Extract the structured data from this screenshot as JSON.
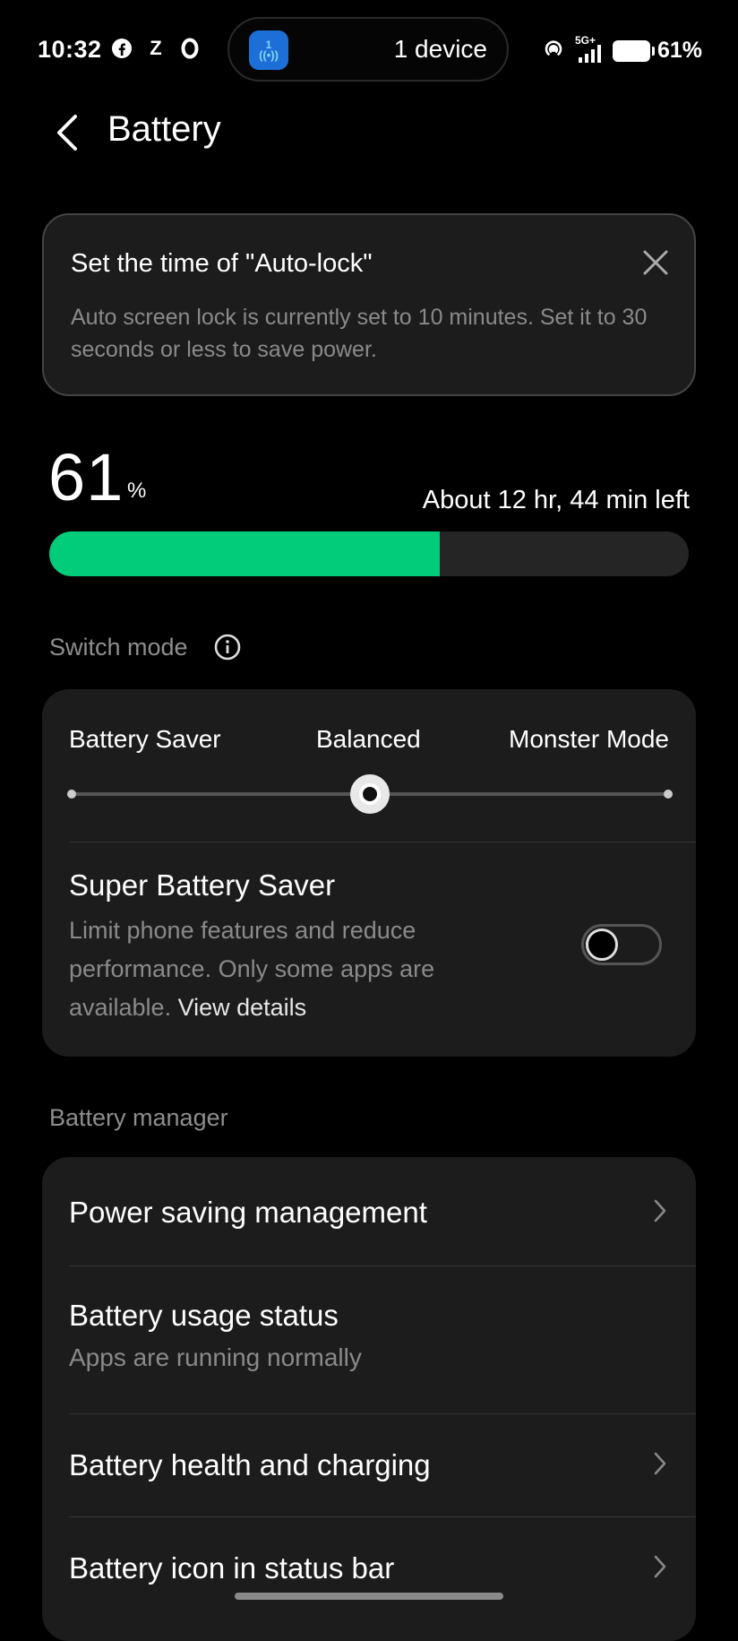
{
  "status_bar": {
    "time": "10:32",
    "left_icons": [
      "facebook-icon",
      "z-icon",
      "o-icon"
    ],
    "left_icon_glyphs": [
      "f",
      "Z",
      "O"
    ],
    "island_app_badge": "1",
    "island_text": "1 device",
    "network": "5G+",
    "battery_percent": "61%"
  },
  "header": {
    "title": "Battery"
  },
  "tip": {
    "title": "Set the time of \"Auto-lock\"",
    "body": "Auto screen lock is currently set to 10 minutes. Set it to 30 seconds or less to save power."
  },
  "battery_level": {
    "value": "61",
    "unit": "%",
    "fill_fraction": 0.61,
    "time_left": "About 12 hr, 44 min left",
    "bar_color": "#00cc7a"
  },
  "switch_mode": {
    "label": "Switch mode",
    "modes": [
      "Battery Saver",
      "Balanced",
      "Monster Mode"
    ],
    "selected": "Balanced"
  },
  "super_saver": {
    "title": "Super Battery Saver",
    "description": "Limit phone features and reduce performance. Only some apps are available.",
    "link": "View details",
    "enabled": false
  },
  "battery_manager": {
    "label": "Battery manager",
    "items": [
      {
        "title": "Power saving management",
        "subtitle": ""
      },
      {
        "title": "Battery usage status",
        "subtitle": "Apps are running normally"
      },
      {
        "title": "Battery health and charging",
        "subtitle": ""
      },
      {
        "title": "Battery icon in status bar",
        "subtitle": ""
      }
    ]
  }
}
